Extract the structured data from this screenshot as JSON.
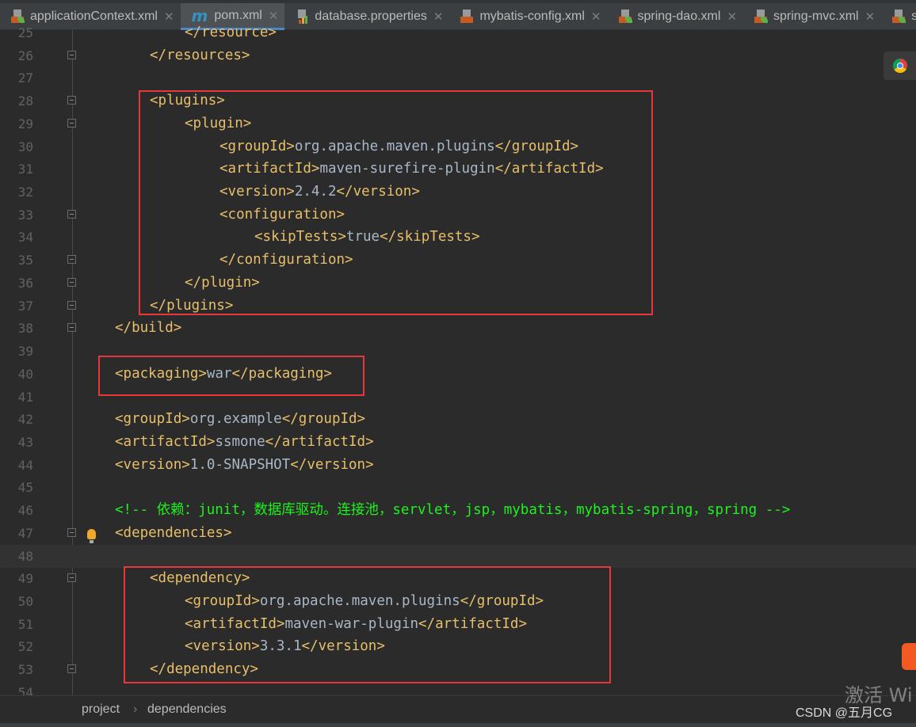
{
  "tabs": [
    {
      "label": "applicationContext.xml",
      "icon": "spring-xml-icon",
      "active": false
    },
    {
      "label": "pom.xml",
      "icon": "maven-icon",
      "active": true
    },
    {
      "label": "database.properties",
      "icon": "properties-icon",
      "active": false
    },
    {
      "label": "mybatis-config.xml",
      "icon": "xml-icon",
      "active": false
    },
    {
      "label": "spring-dao.xml",
      "icon": "spring-xml-icon",
      "active": false
    },
    {
      "label": "spring-mvc.xml",
      "icon": "spring-xml-icon",
      "active": false
    },
    {
      "label": "s",
      "icon": "spring-xml-icon",
      "active": false
    }
  ],
  "editor": {
    "current_line": 48,
    "lines": [
      {
        "n": "25",
        "indent": 2,
        "text": "</resource>"
      },
      {
        "n": "26",
        "indent": 1,
        "text": "</resources>",
        "fold": true
      },
      {
        "n": "27",
        "indent": 0,
        "text": ""
      },
      {
        "n": "28",
        "indent": 1,
        "text": "<plugins>",
        "fold": true
      },
      {
        "n": "29",
        "indent": 2,
        "text": "<plugin>",
        "fold": true
      },
      {
        "n": "30",
        "indent": 3,
        "text": "<groupId>org.apache.maven.plugins</groupId>"
      },
      {
        "n": "31",
        "indent": 3,
        "text": "<artifactId>maven-surefire-plugin</artifactId>"
      },
      {
        "n": "32",
        "indent": 3,
        "text": "<version>2.4.2</version>"
      },
      {
        "n": "33",
        "indent": 3,
        "text": "<configuration>",
        "fold": true
      },
      {
        "n": "34",
        "indent": 4,
        "text": "<skipTests>true</skipTests>"
      },
      {
        "n": "35",
        "indent": 3,
        "text": "</configuration>",
        "fold": true
      },
      {
        "n": "36",
        "indent": 2,
        "text": "</plugin>",
        "fold": true
      },
      {
        "n": "37",
        "indent": 1,
        "text": "</plugins>",
        "fold": true
      },
      {
        "n": "38",
        "indent": 0,
        "text": "</build>",
        "fold": true
      },
      {
        "n": "39",
        "indent": 0,
        "text": ""
      },
      {
        "n": "40",
        "indent": 0,
        "text": "<packaging>war</packaging>"
      },
      {
        "n": "41",
        "indent": 0,
        "text": ""
      },
      {
        "n": "42",
        "indent": 0,
        "text": "<groupId>org.example</groupId>"
      },
      {
        "n": "43",
        "indent": 0,
        "text": "<artifactId>ssmone</artifactId>"
      },
      {
        "n": "44",
        "indent": 0,
        "text": "<version>1.0-SNAPSHOT</version>"
      },
      {
        "n": "45",
        "indent": 0,
        "text": ""
      },
      {
        "n": "46",
        "indent": 0,
        "text": "<!-- 依赖：junit，数据库驱动。连接池，servlet，jsp，mybatis，mybatis-spring，spring -->",
        "comment": true
      },
      {
        "n": "47",
        "indent": 0,
        "text": "<dependencies>",
        "fold": true
      },
      {
        "n": "48",
        "indent": 0,
        "text": ""
      },
      {
        "n": "49",
        "indent": 1,
        "text": "<dependency>",
        "fold": true
      },
      {
        "n": "50",
        "indent": 2,
        "text": "<groupId>org.apache.maven.plugins</groupId>"
      },
      {
        "n": "51",
        "indent": 2,
        "text": "<artifactId>maven-war-plugin</artifactId>"
      },
      {
        "n": "52",
        "indent": 2,
        "text": "<version>3.3.1</version>"
      },
      {
        "n": "53",
        "indent": 1,
        "text": "</dependency>",
        "fold": true
      },
      {
        "n": "54",
        "indent": 0,
        "text": ""
      }
    ]
  },
  "breadcrumb": {
    "items": [
      "project",
      "dependencies"
    ],
    "separator": "›"
  },
  "watermark": {
    "activate": "激活 Wi",
    "csdn": "CSDN @五月CG"
  },
  "colors": {
    "tag": "#e8bf6a",
    "text": "#a9b7c6",
    "comment": "#1cf21c",
    "highlight_box": "#e8373a",
    "background": "#2b2b2b"
  }
}
